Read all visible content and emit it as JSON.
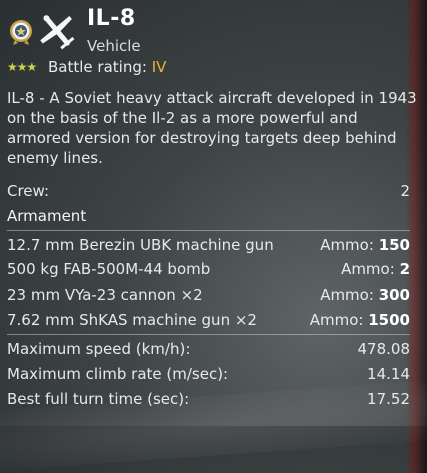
{
  "vehicle": {
    "name": "IL-8",
    "type": "Vehicle",
    "rank_stars": "★★★",
    "battle_rating_label": "Battle rating:",
    "battle_rating_value": "IV",
    "description": "IL-8 - A Soviet heavy attack aircraft developed in 1943 on the basis of the Il-2 as a more powerful and armored version for destroying targets deep behind enemy lines."
  },
  "crew": {
    "label": "Crew:",
    "value": "2"
  },
  "armament": {
    "title": "Armament",
    "ammo_label": "Ammo:",
    "items": [
      {
        "name": "12.7 mm Berezin UBK machine gun",
        "ammo": "150"
      },
      {
        "name": "500 kg FAB-500M-44 bomb",
        "ammo": "2"
      },
      {
        "name": "23 mm VYa-23 cannon ×2",
        "ammo": "300"
      },
      {
        "name": "7.62 mm ShKAS machine gun ×2",
        "ammo": "1500"
      }
    ]
  },
  "stats": [
    {
      "label": "Maximum speed (km/h):",
      "value": "478.08"
    },
    {
      "label": "Maximum climb rate (m/sec):",
      "value": "14.14"
    },
    {
      "label": "Best full turn time (sec):",
      "value": "17.52"
    }
  ],
  "colors": {
    "accent_br": "#e8b53a",
    "stars": "#c9d34a",
    "text": "#e6e9ec"
  },
  "icons": {
    "badge": "rank-medal-icon",
    "plane": "attack-aircraft-icon"
  }
}
